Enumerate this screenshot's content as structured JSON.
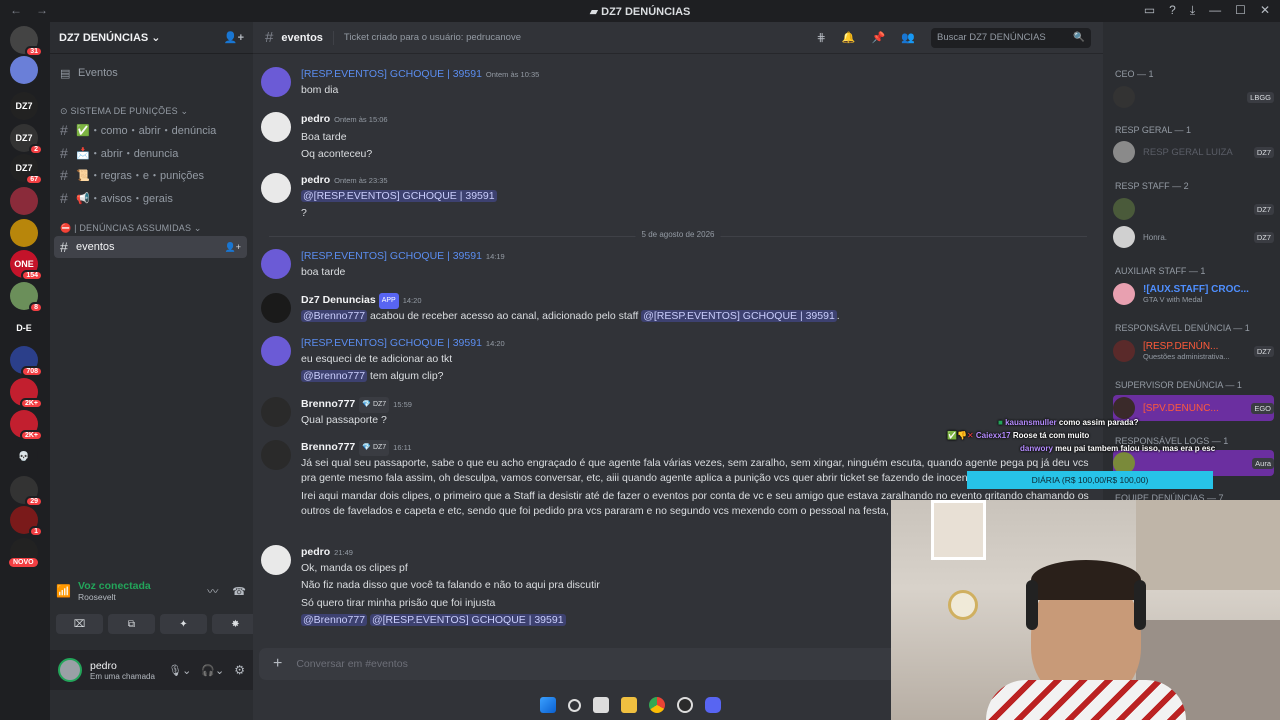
{
  "window": {
    "title": "DZ7 DENÚNCIAS"
  },
  "servers": [
    {
      "label": "",
      "badge": "31",
      "color": "#444"
    },
    {
      "label": "",
      "badge": "",
      "color": "#6a7fd8"
    },
    {
      "label": "DZ7",
      "badge": "",
      "color": "#222"
    },
    {
      "label": "DZ7",
      "badge": "2",
      "color": "#333"
    },
    {
      "label": "DZ7",
      "badge": "67",
      "color": "#222"
    },
    {
      "label": "",
      "badge": "",
      "color": "#8a2b3a"
    },
    {
      "label": "",
      "badge": "",
      "color": "#b8860b"
    },
    {
      "label": "ONE",
      "badge": "154",
      "color": "#c4132a"
    },
    {
      "label": "",
      "badge": "8",
      "color": "#6b8f5a"
    },
    {
      "label": "D-E",
      "badge": "",
      "color": "#1e1f22"
    },
    {
      "label": "",
      "badge": "708",
      "color": "#2b3f8a"
    },
    {
      "label": "",
      "badge": "2K+",
      "color": "#c21f2f"
    },
    {
      "label": "",
      "badge": "2K+",
      "color": "#c21f2f"
    },
    {
      "label": "💀",
      "badge": "",
      "color": "#1e1f22"
    },
    {
      "label": "",
      "badge": "29",
      "color": "#333"
    },
    {
      "label": "",
      "badge": "1",
      "color": "#7a1a1a"
    },
    {
      "label": "",
      "badge": "",
      "color": "#222"
    }
  ],
  "servers_new": "NOVO",
  "sidebar": {
    "server_name": "DZ7 DENÚNCIAS",
    "top_item": "Eventos",
    "cat1": "SISTEMA DE PUNIÇÕES",
    "channels": [
      {
        "emoji": "✅",
        "label": "・como・abrir・denúncia"
      },
      {
        "emoji": "📩",
        "label": "・abrir・denuncia"
      },
      {
        "emoji": "📜",
        "label": "・regras・e・punições"
      },
      {
        "emoji": "📢",
        "label": "・avisos・gerais"
      }
    ],
    "cat2": "| DENÚNCIAS ASSUMIDAS",
    "active_channel": "eventos",
    "voice_status": "Voz conectada",
    "voice_channel": "Roosevelt",
    "user_name": "pedro",
    "user_status": "Em uma chamada"
  },
  "header": {
    "channel": "eventos",
    "topic": "Ticket criado para o usuário: pedrucanove",
    "search_placeholder": "Buscar DZ7 DENÚNCIAS"
  },
  "messages": [
    {
      "author": "[RESP.EVENTOS] GCHOQUE | 39591",
      "time": "Ontem às 10:35",
      "lines": [
        "bom dia"
      ]
    },
    {
      "author": "pedro",
      "time": "Ontem às 15:06",
      "lines": [
        "Boa tarde",
        "Oq aconteceu?"
      ]
    },
    {
      "author": "pedro",
      "time": "Ontem às 23:35",
      "mention": "@[RESP.EVENTOS] GCHOQUE | 39591",
      "lines": [
        "?"
      ]
    },
    {
      "author": "[RESP.EVENTOS] GCHOQUE | 39591",
      "time": "14:19",
      "lines": [
        "boa tarde"
      ]
    },
    {
      "author": "Dz7 Denuncias",
      "app": "APP",
      "time": "14:20",
      "mention_a": "@Brenno777",
      "text": " acabou de receber acesso ao canal, adicionado pelo staff ",
      "mention_b": "@[RESP.EVENTOS] GCHOQUE | 39591",
      "tail": "."
    },
    {
      "author": "[RESP.EVENTOS] GCHOQUE | 39591",
      "time": "14:20",
      "line1": "eu esqueci de te adicionar ao tkt",
      "mention": "@Brenno777",
      "line2": " tem algum clip?"
    },
    {
      "author": "Brenno777",
      "tag": "💎 DZ7",
      "time": "15:59",
      "lines": [
        "Qual passaporte ?"
      ]
    },
    {
      "author": "Brenno777",
      "tag": "💎 DZ7",
      "time": "16:11",
      "lines": [
        "Já sei qual seu passaporte, sabe o que eu acho engraçado é que agente fala várias vezes, sem zaralho, sem xingar, ninguém escuta, quando agente pega pq já deu vcs pra gente mesmo fala assim, oh desculpa, vamos conversar, etc, aiii quando agente aplica a punição vcs quer abrir ticket se fazendo de inocente que não",
        "Irei aqui mandar dois clipes, o primeiro que a Staff ia desistir até de fazer o eventos por conta de vc e seu amigo que estava zaralhando no evento gritando chamando os outros de favelados e capeta e etc, sendo que foi pedido pra vcs pararam e no segundo vcs mexendo com o pessoal na festa, e tant que estavam ali"
      ]
    },
    {
      "author": "pedro",
      "time": "21:49",
      "lines": [
        "Ok, manda os clipes pf",
        "Não fiz nada disso que você ta falando e não to aqui pra discutir",
        "Só quero tirar minha prisão que foi injusta"
      ],
      "mention_a": "@Brenno777",
      "mention_b": "@[RESP.EVENTOS] GCHOQUE | 39591"
    }
  ],
  "date_divider": "5 de agosto de 2026",
  "composer_placeholder": "Conversar em #eventos",
  "members": {
    "groups": [
      {
        "title": "CEO — 1",
        "rows": [
          {
            "name": "",
            "tag": "LBGG"
          }
        ]
      },
      {
        "title": "RESP GERAL — 1",
        "rows": [
          {
            "name": "RESP GERAL LUIZA",
            "tag": "DZ7"
          }
        ]
      },
      {
        "title": "RESP STAFF — 2",
        "rows": [
          {
            "name": "",
            "tag": "DZ7"
          },
          {
            "name": "Honra.",
            "tag": "DZ7"
          }
        ]
      },
      {
        "title": "AUXILIAR STAFF — 1",
        "rows": [
          {
            "name": "![AUX.STAFF] CROC...",
            "sub": "GTA V with Medal",
            "tag": ""
          }
        ]
      },
      {
        "title": "RESPONSÁVEL DENÚNCIA — 1",
        "rows": [
          {
            "name": "[RESP.DENÚN...",
            "sub": "Questões administrativa...",
            "tag": "DZ7"
          }
        ]
      },
      {
        "title": "SUPERVISOR DENÚNCIA — 1",
        "rows": [
          {
            "name": "[SPV.DENUNC...",
            "tag": "EGO"
          }
        ]
      },
      {
        "title": "RESPONSÁVEL LOGS — 1",
        "rows": [
          {
            "name": "",
            "tag": "Aura"
          }
        ]
      },
      {
        "title": "EQUIPE DENÚNCIAS — 7",
        "rows": []
      }
    ]
  },
  "overlay": {
    "chat": [
      {
        "user": "kauansmuller",
        "text": "como assim parada?"
      },
      {
        "user": "Caiexx17",
        "text": "Roose tá com muito"
      },
      {
        "user": "danwory",
        "text": "meu pai tambem falou isso, mas era p esc"
      }
    ],
    "diaria": "DIÁRIA (R$ 100,00/R$ 100,00)"
  },
  "colors": {
    "accent": "#5865f2",
    "mention_bg": "#3c4270",
    "danger": "#f23f43",
    "online": "#23a55a"
  }
}
